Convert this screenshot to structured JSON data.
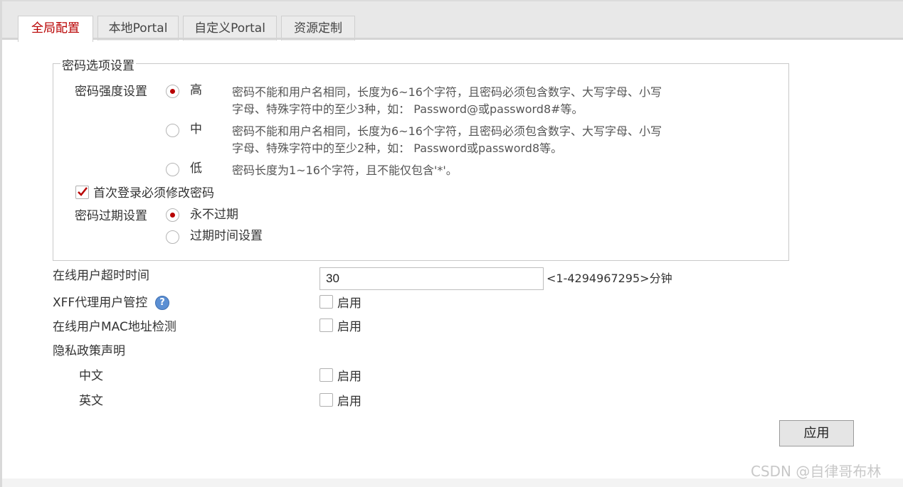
{
  "tabs": [
    {
      "label": "全局配置",
      "active": true
    },
    {
      "label": "本地Portal",
      "active": false
    },
    {
      "label": "自定义Portal",
      "active": false
    },
    {
      "label": "资源定制",
      "active": false
    }
  ],
  "password_options": {
    "legend": "密码选项设置",
    "strength_label": "密码强度设置",
    "strength_options": [
      {
        "label": "高",
        "selected": true,
        "desc_line1": "密码不能和用户名相同，长度为6~16个字符，且密码必须包含数字、大写字母、小写",
        "desc_line2": "字母、特殊字符中的至少3种，如： Password@或password8#等。"
      },
      {
        "label": "中",
        "selected": false,
        "desc_line1": "密码不能和用户名相同，长度为6~16个字符，且密码必须包含数字、大写字母、小写",
        "desc_line2": "字母、特殊字符中的至少2种，如： Password或password8等。"
      },
      {
        "label": "低",
        "selected": false,
        "desc_line1": "密码长度为1~16个字符，且不能仅包含'*'。"
      }
    ],
    "first_login_change": {
      "label": "首次登录必须修改密码",
      "checked": true
    },
    "expiry_label": "密码过期设置",
    "expiry_options": [
      {
        "label": "永不过期",
        "selected": true
      },
      {
        "label": "过期时间设置",
        "selected": false
      }
    ]
  },
  "online_timeout": {
    "label": "在线用户超时时间",
    "value": "30",
    "hint": "<1-4294967295>分钟"
  },
  "xff": {
    "label": "XFF代理用户管控",
    "help_icon": "?",
    "enable_label": "启用",
    "checked": false
  },
  "mac_check": {
    "label": "在线用户MAC地址检测",
    "enable_label": "启用",
    "checked": false
  },
  "privacy": {
    "label": "隐私政策声明",
    "items": [
      {
        "label": "中文",
        "enable_label": "启用",
        "checked": false
      },
      {
        "label": "英文",
        "enable_label": "启用",
        "checked": false
      }
    ]
  },
  "apply_label": "应用",
  "watermark": "CSDN @自律哥布林",
  "colors": {
    "accent": "#b80000",
    "help": "#5b8fd3"
  }
}
